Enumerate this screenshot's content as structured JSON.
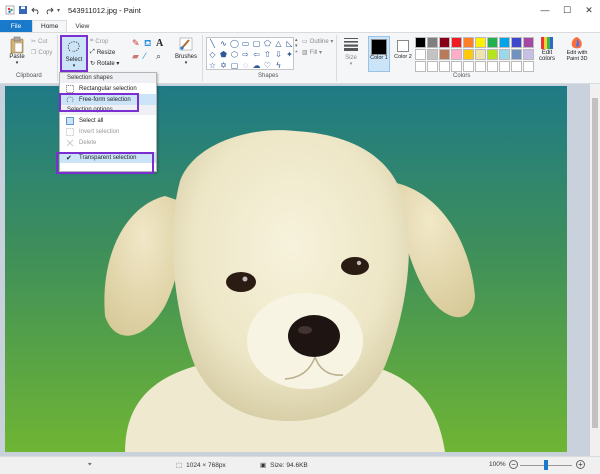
{
  "window": {
    "title": "543911012.jpg - Paint",
    "minimize": "—",
    "maximize": "☐",
    "close": "✕"
  },
  "tabs": [
    "File",
    "Home",
    "View"
  ],
  "ribbon": {
    "clipboard": {
      "label": "Clipboard",
      "paste": "Paste",
      "cut": "Cut",
      "copy": "Copy"
    },
    "image": {
      "select": "Select",
      "crop": "Crop",
      "resize": "Resize",
      "rotate": "Rotate ▾"
    },
    "tools": {
      "brushes": "Brushes"
    },
    "shapes": {
      "label": "Shapes",
      "outline": "Outline ▾",
      "fill": "Fill ▾"
    },
    "size": {
      "label": "Size"
    },
    "colors": {
      "label": "Colors",
      "color1": "Color 1",
      "color2": "Color 2",
      "edit_colors": "Edit colors",
      "edit_paint3d": "Edit with Paint 3D",
      "palette": [
        "#000000",
        "#7f7f7f",
        "#880015",
        "#ed1c24",
        "#ff7f27",
        "#fff200",
        "#22b14c",
        "#00a2e8",
        "#3f48cc",
        "#a349a4",
        "#ffffff",
        "#c3c3c3",
        "#b97a57",
        "#ffaec9",
        "#ffc90e",
        "#efe4b0",
        "#b5e61d",
        "#99d9ea",
        "#7092be",
        "#c8bfe7",
        "#ffffff",
        "#ffffff",
        "#ffffff",
        "#ffffff",
        "#ffffff",
        "#ffffff",
        "#ffffff",
        "#ffffff",
        "#ffffff",
        "#ffffff"
      ]
    }
  },
  "select_menu": {
    "header_shapes": "Selection shapes",
    "rectangular": "Rectangular selection",
    "freeform": "Free-form selection",
    "header_options": "Selection options",
    "select_all": "Select all",
    "invert": "Invert selection",
    "delete": "Delete",
    "transparent": "Transparent selection"
  },
  "status": {
    "dimensions": "1024 × 768px",
    "size": "Size: 94.6KB",
    "zoom": "100%"
  },
  "accent": "#7b2fd1",
  "file_tab_color": "#1979ca"
}
